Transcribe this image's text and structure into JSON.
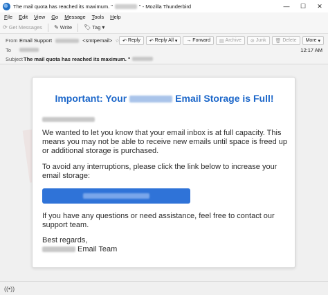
{
  "window": {
    "title_prefix": "The mail quota has reached its maximum. \"",
    "title_suffix": "\" - Mozilla Thunderbird",
    "minimize": "—",
    "maximize": "☐",
    "close": "✕"
  },
  "menu": {
    "items": [
      {
        "label": "File",
        "u": "F",
        "rest": "ile"
      },
      {
        "label": "Edit",
        "u": "E",
        "rest": "dit"
      },
      {
        "label": "View",
        "u": "V",
        "rest": "iew"
      },
      {
        "label": "Go",
        "u": "G",
        "rest": "o"
      },
      {
        "label": "Message",
        "u": "M",
        "rest": "essage"
      },
      {
        "label": "Tools",
        "u": "T",
        "rest": "ools"
      },
      {
        "label": "Help",
        "u": "H",
        "rest": "elp"
      }
    ]
  },
  "toolbar": {
    "get_messages": "Get Messages",
    "write": "Write",
    "tag": "Tag"
  },
  "header": {
    "from_label": "From",
    "from_name": "Email Support",
    "from_addr": "<smtpemail>",
    "to_label": "To",
    "subject_label": "Subject",
    "subject": "The mail quota has reached its maximum. \"",
    "time": "12:17 AM",
    "actions": {
      "reply": "Reply",
      "reply_all": "Reply All",
      "forward": "Forward",
      "archive": "Archive",
      "junk": "Junk",
      "delete": "Delete",
      "more": "More"
    }
  },
  "email": {
    "title_before": "Important: Your",
    "title_after": "Email Storage is Full!",
    "para1": "We wanted to let you know that your email inbox is at full capacity. This means you may not be able to receive new emails until space is freed up or additional storage is purchased.",
    "para2": "To avoid any interruptions, please click the link below to increase your email storage:",
    "para3": "If you have any questions or need assistance, feel free to contact our support team.",
    "regards": "Best regards,",
    "team": "Email Team"
  },
  "colors": {
    "accent": "#1b66c9",
    "button": "#2f73d8"
  },
  "icons": {
    "app": "thunderbird-icon",
    "status": "wifi-icon"
  }
}
